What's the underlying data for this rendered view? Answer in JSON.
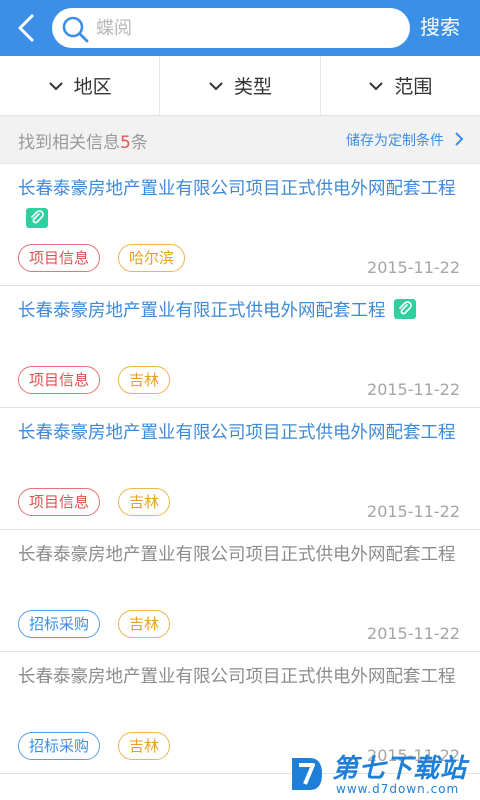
{
  "header": {
    "search_placeholder": "蝶阅",
    "search_label": "搜索"
  },
  "filters": [
    {
      "label": "地区"
    },
    {
      "label": "类型"
    },
    {
      "label": "范围"
    }
  ],
  "summary": {
    "prefix": "找到相关信息",
    "count": "5",
    "suffix": "条",
    "save_label": "储存为定制条件"
  },
  "results": [
    {
      "title": "长春泰豪房地产置业有限公司项目正式供电外网配套工程",
      "tag_type": "项目信息",
      "tag_city": "哈尔滨",
      "date": "2015-11-22",
      "attachment": true
    },
    {
      "title": "长春泰豪房地产置业有限正式供电外网配套工程",
      "tag_type": "项目信息",
      "tag_city": "吉林",
      "date": "2015-11-22",
      "attachment": true
    },
    {
      "title": "长春泰豪房地产置业有限公司项目正式供电外网配套工程",
      "tag_type": "项目信息",
      "tag_city": "吉林",
      "date": "2015-11-22",
      "attachment": false
    },
    {
      "title": "长春泰豪房地产置业有限公司项目正式供电外网配套工程",
      "tag_type": "招标采购",
      "tag_city": "吉林",
      "date": "2015-11-22",
      "attachment": false
    },
    {
      "title": "长春泰豪房地产置业有限公司项目正式供电外网配套工程",
      "tag_type": "招标采购",
      "tag_city": "吉林",
      "date": "2015-11-22",
      "attachment": false
    }
  ],
  "watermark": {
    "title": "第七下载站",
    "url": "www.d7down.com"
  },
  "colors": {
    "accent": "#3b8fe6",
    "count_red": "#e85555",
    "tag_red": "#d9534f",
    "tag_orange": "#e9a020",
    "attachment_green": "#2fd0a0"
  }
}
